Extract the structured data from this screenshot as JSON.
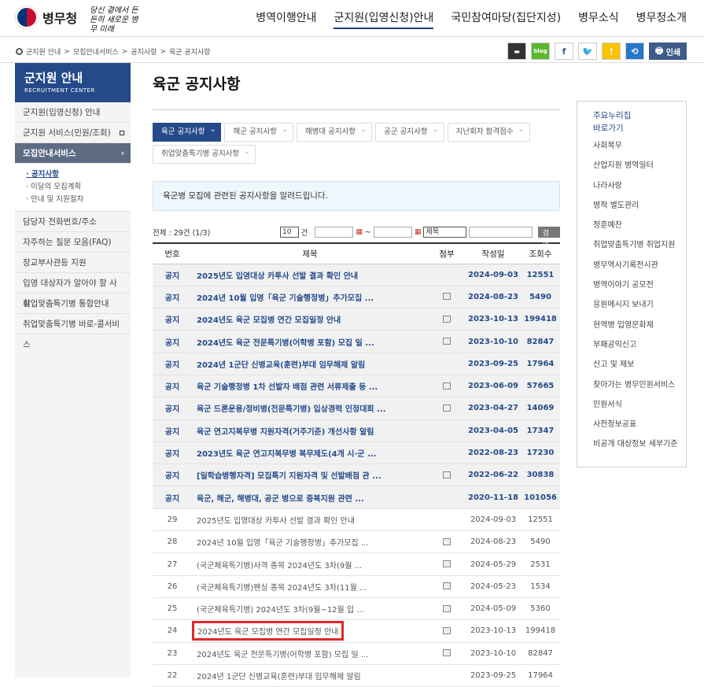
{
  "header": {
    "logo_text": "병무청",
    "slogan": "당신 곁에서 든든히 새로운 병무 미래",
    "nav": [
      "병역이행안내",
      "군지원(입영신청)안내",
      "국민참여마당(집단지성)",
      "병무소식",
      "병무청소개"
    ]
  },
  "breadcrumb": [
    "군지원 안내",
    "모집안내서비스",
    "공지사항",
    "육군 공지사항"
  ],
  "toolbar": {
    "print_label": "인쇄",
    "blog_label": "blog"
  },
  "sidebar": {
    "title": "군지원 안내",
    "subtitle": "RECRUITMENT CENTER",
    "items": [
      "군지원(입영신청) 안내",
      "군지원 서비스(민원/조회)",
      "모집안내서비스",
      "담당자 전화번호/주소",
      "자주하는 질문 모음(FAQ)",
      "장교부사관등 지원",
      "입영 대상자가 알아야 할 사항",
      "취업맞춤특기병 통합안내",
      "취업맞춤특기병 바로-콜서비스"
    ],
    "subitems": [
      "· 공지사항",
      "· 이달의 모집계획",
      "· 안내 및 지원절차"
    ]
  },
  "main": {
    "title": "육군 공지사항",
    "tabs": [
      "육군 공지사항",
      "해군 공지사항",
      "해병대 공지사항",
      "공군 공지사항",
      "지난회차 합격점수",
      "취업맞춤특기병 공지사항"
    ],
    "notice": "육군병 모집에 관련된 공지사항을 알려드립니다.",
    "count": "전체 : 29건 (1/3)",
    "filter": {
      "per_page": "10",
      "unit": "건",
      "tilde": "~",
      "search_field": "제목",
      "search_button": "검색"
    },
    "table": {
      "headers": [
        "번호",
        "제목",
        "첨부",
        "작성일",
        "조회수"
      ],
      "rows": [
        {
          "num": "공지",
          "title": "2025년도 입영대상 카투사 선발 결과 확인 안내",
          "date": "2024-09-03",
          "views": "12551"
        },
        {
          "num": "공지",
          "title": "2024년 10월 입영「육군 기술행정병」추가모집 ...",
          "date": "2024-08-23",
          "views": "5490"
        },
        {
          "num": "공지",
          "title": "2024년도 육군 모집병 연간 모집일정 안내",
          "date": "2023-10-13",
          "views": "199418"
        },
        {
          "num": "공지",
          "title": "2024년도 육군 전문특기병(어학병 포함) 모집 일 ...",
          "date": "2023-10-10",
          "views": "82847"
        },
        {
          "num": "공지",
          "title": "2024년 1군단 신병교육(훈련)부대 임무해제 알림",
          "date": "2023-09-25",
          "views": "17964"
        },
        {
          "num": "공지",
          "title": "육군 기술행정병 1차 선발자 배점 관련 서류제출 등 ...",
          "date": "2023-06-09",
          "views": "57665"
        },
        {
          "num": "공지",
          "title": "육군 드론운용/정비병(전문특기병) 입상경력 인정대회 ...",
          "date": "2023-04-27",
          "views": "14069"
        },
        {
          "num": "공지",
          "title": "육군 연고지복무병 지원자격(거주기준) 개선사항 알림",
          "date": "2023-04-05",
          "views": "17347"
        },
        {
          "num": "공지",
          "title": "2023년도 육군 연고지복무병 복무제도(4개 시·군 ...",
          "date": "2022-08-23",
          "views": "17230"
        },
        {
          "num": "공지",
          "title": "[일학습병행자격] 모집특기 지원자격 및 선발배점 관 ...",
          "date": "2022-06-22",
          "views": "30838"
        },
        {
          "num": "공지",
          "title": "육군, 해군, 해병대, 공군 병으로 중복지원 관련 ...",
          "date": "2020-11-18",
          "views": "101056"
        },
        {
          "num": "29",
          "title": "2025년도 입영대상 카투사 선발 결과 확인 안내",
          "date": "2024-09-03",
          "views": "12551"
        },
        {
          "num": "28",
          "title": "2024년 10월 입영「육군 기술행정병」추가모집 ...",
          "date": "2024-08-23",
          "views": "5490"
        },
        {
          "num": "27",
          "title": "(국군체육특기병)사격 종목 2024년도 3차(9월 ...",
          "date": "2024-05-29",
          "views": "2531"
        },
        {
          "num": "26",
          "title": "(국군체육특기병)펜싱 종목 2024년도 3차(11월 ...",
          "date": "2024-05-23",
          "views": "1534"
        },
        {
          "num": "25",
          "title": "(국군체육특기병) 2024년도 3차(9월~12월 입 ...",
          "date": "2024-05-09",
          "views": "5360"
        },
        {
          "num": "24",
          "title": "2024년도 육군 모집병 연간 모집일정 안내",
          "date": "2023-10-13",
          "views": "199418"
        },
        {
          "num": "23",
          "title": "2024년도 육군 전문특기병(어학병 포함) 모집 일 ...",
          "date": "2023-10-10",
          "views": "82847"
        },
        {
          "num": "22",
          "title": "2024년 1군단 신병교육(훈련)부대 임무해제 알림",
          "date": "2023-09-25",
          "views": "17964"
        }
      ]
    }
  },
  "quick": {
    "title1": "주요누리집",
    "title2": "바로가기",
    "items": [
      "사회복무",
      "산업지원 병역일터",
      "나라사랑",
      "병적 별도관리",
      "정훈예찬",
      "취업맞춤특기병 취업지원",
      "병무역사기록전시관",
      "병역이야기 공모전",
      "응원메시지 보내기",
      "현역병 입영문화제",
      "부패공익신고",
      "신고 및 제보",
      "찾아가는 병무민원서비스",
      "민원서식",
      "사전정보공표",
      "비공개 대상정보 세부기준"
    ]
  }
}
